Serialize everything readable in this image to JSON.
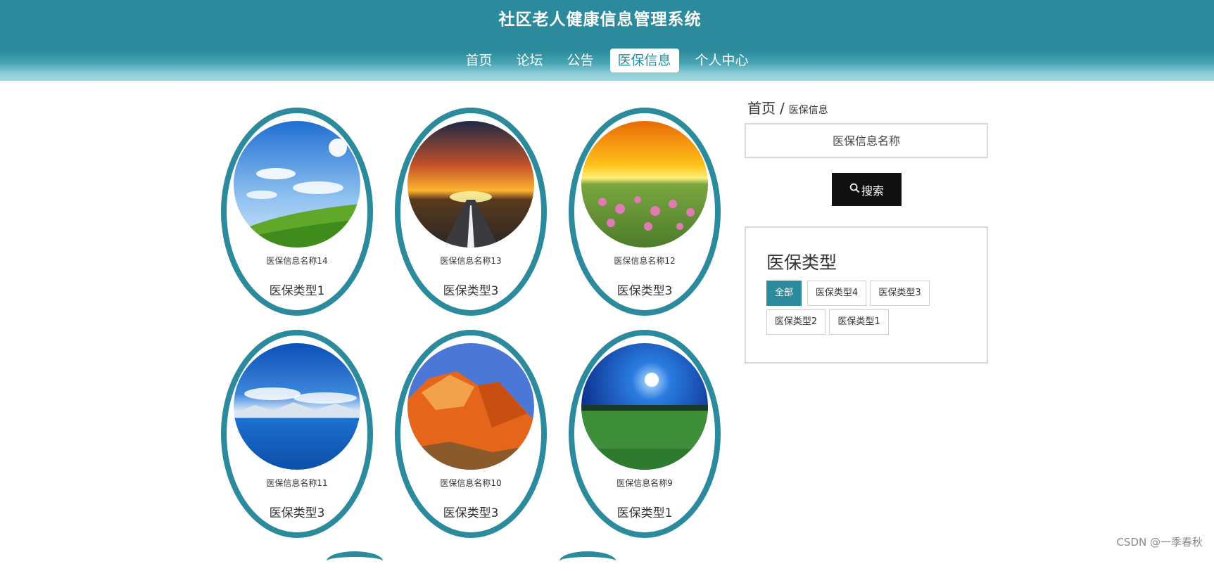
{
  "header": {
    "title": "社区老人健康信息管理系统",
    "nav": [
      "首页",
      "论坛",
      "公告",
      "医保信息",
      "个人中心"
    ],
    "active_nav": "医保信息"
  },
  "breadcrumb": {
    "home": "首页",
    "separator": "/",
    "current": "医保信息"
  },
  "search": {
    "placeholder": "医保信息名称",
    "button_label": "搜索",
    "button_icon": "search-icon"
  },
  "type_filter": {
    "title": "医保类型",
    "tags": [
      "全部",
      "医保类型4",
      "医保类型3",
      "医保类型2",
      "医保类型1"
    ],
    "active": "全部"
  },
  "items": [
    {
      "name": "医保信息名称14",
      "type": "医保类型1",
      "image": "sky-meadow"
    },
    {
      "name": "医保信息名称13",
      "type": "医保类型3",
      "image": "sunset-road"
    },
    {
      "name": "医保信息名称12",
      "type": "医保类型3",
      "image": "flower-field-sunset"
    },
    {
      "name": "医保信息名称11",
      "type": "医保类型3",
      "image": "blue-lake-mountains"
    },
    {
      "name": "医保信息名称10",
      "type": "医保类型3",
      "image": "orange-mountain"
    },
    {
      "name": "医保信息名称9",
      "type": "医保类型1",
      "image": "night-moon-field"
    }
  ],
  "watermark": "CSDN @一季春秋",
  "colors": {
    "primary": "#2b8a9b",
    "button_dark": "#111111"
  }
}
